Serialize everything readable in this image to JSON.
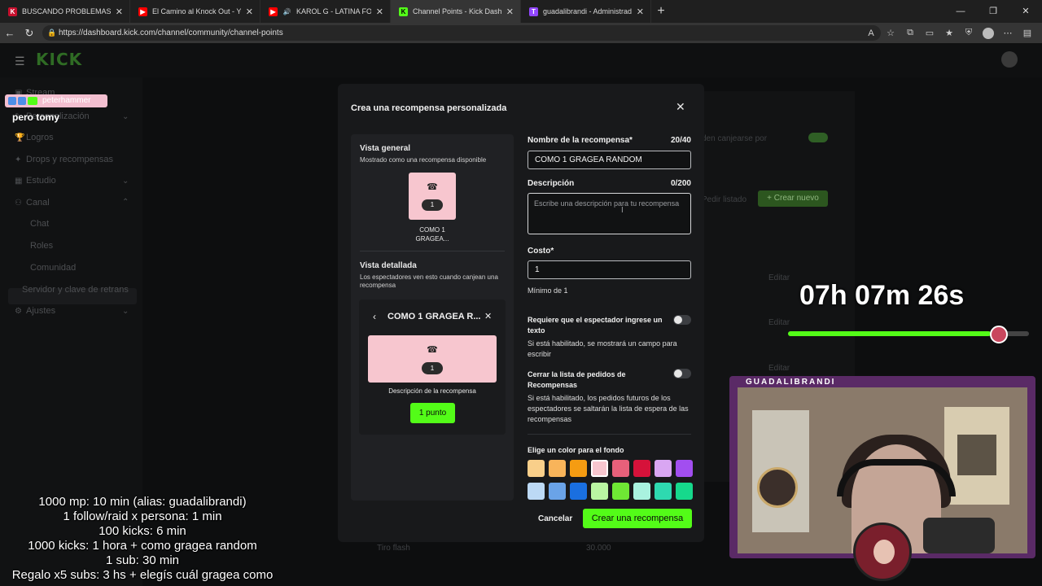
{
  "browser": {
    "tabs": [
      {
        "title": "BUSCANDO PROBLEMAS EN FLOR",
        "icon": "kick-icon",
        "color": "#c8102e",
        "active": false
      },
      {
        "title": "El Camino al Knock Out - YouTube",
        "icon": "youtube-icon",
        "color": "#ff0000",
        "active": false
      },
      {
        "title": "KAROL G - LATINA FOREVA (",
        "icon": "youtube-icon",
        "color": "#ff0000",
        "active": false
      },
      {
        "title": "Channel Points - Kick Dashboard",
        "icon": "kick-icon",
        "color": "#53fc18",
        "active": true
      },
      {
        "title": "guadalibrandi - Administrador de",
        "icon": "twitch-icon",
        "color": "#9146ff",
        "active": false
      }
    ],
    "url": "https://dashboard.kick.com/channel/community/channel-points"
  },
  "page": {
    "logo": "KICK",
    "sidebar": {
      "items": [
        {
          "label": "Stream",
          "icon": "video-icon"
        },
        {
          "label": "Personalización",
          "icon": "brush-icon"
        },
        {
          "label": "Logros",
          "icon": "trophy-icon"
        },
        {
          "label": "Drops y recompensas",
          "icon": "gift-icon"
        },
        {
          "label": "Estudio",
          "icon": "studio-icon"
        },
        {
          "label": "Canal",
          "icon": "people-icon"
        },
        {
          "label": "Chat"
        },
        {
          "label": "Roles"
        },
        {
          "label": "Comunidad"
        },
        {
          "label": "Servidor y clave de retrans"
        },
        {
          "label": "Ajustes",
          "icon": "gear-icon"
        }
      ]
    },
    "background": {
      "toggle_text": "den canjearse por",
      "pedir_text": "Pedir listado",
      "create_new": "+ Crear nuevo",
      "edit_labels": [
        "Editar",
        "Editar",
        "Editar"
      ],
      "last_row_name": "Tiro flash",
      "last_row_cost": "30.000"
    }
  },
  "modal": {
    "title": "Crea una recompensa personalizada",
    "overview": {
      "heading": "Vista general",
      "subheading": "Mostrado como una recompensa disponible",
      "card_cost": "1",
      "card_caption_line1": "COMO 1",
      "card_caption_line2": "GRAGEA..."
    },
    "detail": {
      "heading": "Vista detallada",
      "subheading": "Los espectadores ven esto cuando canjean una recompensa",
      "title": "COMO 1 GRAGEA R...",
      "card_cost": "1",
      "description": "Descripción de la recompensa",
      "button": "1 punto"
    },
    "form": {
      "name_label": "Nombre de la recompensa*",
      "name_count": "20/40",
      "name_value": "COMO 1 GRAGEA RANDOM",
      "desc_label": "Descripción",
      "desc_count": "0/200",
      "desc_placeholder": "Escribe una descripción para tu recompensa",
      "cost_label": "Costo*",
      "cost_value": "1",
      "cost_hint": "Mínimo de 1",
      "input_req_label": "Requiere que el espectador ingrese un texto",
      "input_req_help": "Si está habilitado, se mostrará un campo para escribir",
      "close_queue_label": "Cerrar la lista de pedidos de Recompensas",
      "close_queue_help": "Si está habilitado, los pedidos futuros de los espectadores se saltarán la lista de espera de las recompensas",
      "color_label": "Elige un color para el fondo",
      "colors": [
        "#f9cf8a",
        "#f8b45a",
        "#f59c12",
        "#f7c6cf",
        "#e8607a",
        "#d6123a",
        "#d9a6f2",
        "#a24ef0",
        "#bcd9f5",
        "#6aa3e8",
        "#1a6fe0",
        "#b9f5a2",
        "#6fe834",
        "#a9f2df",
        "#2ed9b0",
        "#16d98c"
      ],
      "selected_color_index": 3
    },
    "cancel": "Cancelar",
    "create": "Crear una recompensa"
  },
  "overlay": {
    "chat_user": "peterhammer",
    "chat_msg": "pero tomy",
    "timer": "07h 07m 26s",
    "timer_progress": 0.84,
    "cam_name": "GUADALIBRANDI",
    "goals": [
      "1000 mp: 10 min (alias: guadalibrandi)",
      "1 follow/raid x persona: 1 min",
      "100 kicks: 6 min",
      "1000 kicks: 1 hora + como gragea random",
      "1 sub: 30 min",
      "Regalo x5 subs: 3 hs + elegís cuál gragea como"
    ]
  }
}
